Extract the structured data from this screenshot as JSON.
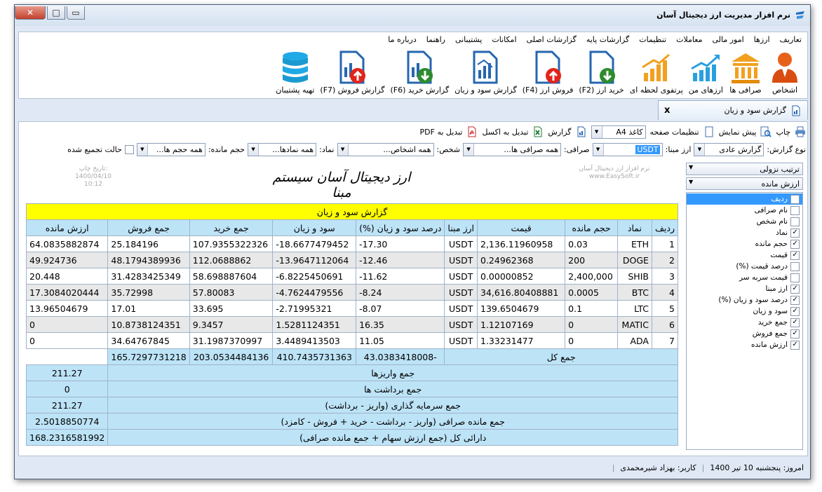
{
  "window": {
    "title": "نرم افزار مدیریت ارز دیجیتال آسان",
    "close": "✕",
    "maximize": "□",
    "minimize": "▭"
  },
  "menu": [
    "تعاریف",
    "ارزها",
    "امور مالی",
    "معاملات",
    "تنظیمات",
    "گزارشات پایه",
    "گزارشات اصلی",
    "امکانات",
    "پشتیبانی",
    "راهنما",
    "درباره ما"
  ],
  "toolbar": [
    {
      "label": "اشخاص",
      "icon": "person-icon"
    },
    {
      "label": "صرافی ها",
      "icon": "bank-icon"
    },
    {
      "label": "ارزهای من",
      "icon": "chart-up-icon"
    },
    {
      "label": "پرتفوی لحظه ای",
      "icon": "bar-chart-icon"
    },
    {
      "label": "خرید ارز (F2)",
      "icon": "buy-doc-icon"
    },
    {
      "label": "فروش ارز (F4)",
      "icon": "sell-doc-icon"
    },
    {
      "label": "گزارش سود و زیان",
      "icon": "report-icon"
    },
    {
      "label": "گزارش خرید (F6)",
      "icon": "report-buy-icon"
    },
    {
      "label": "گزارش فروش (F7)",
      "icon": "report-sell-icon"
    },
    {
      "label": "تهیه پشتیبان",
      "icon": "database-icon"
    }
  ],
  "tab": {
    "label": "گزارش سود و زیان",
    "close": "x"
  },
  "actions": {
    "print": "چاپ",
    "preview": "پیش نمایش",
    "page_settings": "تنظیمات صفحه",
    "paper": "کاغذ A4",
    "report": "گزارش",
    "excel": "تبدیل به اکسل",
    "pdf": "تبدیل به PDF"
  },
  "filters": {
    "type_label": "نوع گزارش:",
    "type_value": "گزارش عادی",
    "base_label": "ارز مبنا:",
    "base_value": "USDT",
    "exchange_label": "صرافی:",
    "exchange_value": "همه صرافی ها...",
    "person_label": "شخص:",
    "person_value": "همه اشخاص...",
    "symbol_label": "نماد:",
    "symbol_value": "همه نمادها...",
    "volume_label": "حجم مانده:",
    "volume_value": "همه حجم ها...",
    "aggregate_label": "حالت تجمیع شده"
  },
  "report": {
    "title": "ارز دیجیتال آسان سیستم مبنا",
    "print_date_label": "تاریخ چاپ:",
    "print_date": "1400/04/10",
    "print_time": "10:12",
    "company": "نرم افزار ارز دیجیتال آسان",
    "site": "www.EasySoft.ir",
    "caption": "گزارش سود و زیان",
    "columns": [
      "ردیف",
      "نماد",
      "حجم مانده",
      "قیمت",
      "ارز مبنا",
      "درصد سود و زیان (%)",
      "سود و زیان",
      "جمع خرید",
      "جمع فروش",
      "ارزش مانده"
    ],
    "rows": [
      [
        "1",
        "ETH",
        "0.03",
        "2,136.11960958",
        "USDT",
        "-17.30",
        "-18.6677479452",
        "107.9355322326",
        "25.184196",
        "64.0835882874"
      ],
      [
        "2",
        "DOGE",
        "200",
        "0.24962368",
        "USDT",
        "-12.46",
        "-13.9647112064",
        "112.0688862",
        "48.1794389936",
        "49.924736"
      ],
      [
        "3",
        "SHIB",
        "2,400,000",
        "0.00000852",
        "USDT",
        "-11.62",
        "-6.8225450691",
        "58.698887604",
        "31.4283425349",
        "20.448"
      ],
      [
        "4",
        "BTC",
        "0.0005",
        "34,616.80408881",
        "USDT",
        "-8.24",
        "-4.7624479556",
        "57.80083",
        "35.72998",
        "17.3084020444"
      ],
      [
        "5",
        "LTC",
        "0.1",
        "139.6504679",
        "USDT",
        "-8.07",
        "-2.71995321",
        "33.695",
        "17.01",
        "13.96504679"
      ],
      [
        "6",
        "MATIC",
        "0",
        "1.12107169",
        "USDT",
        "16.35",
        "1.5281124351",
        "9.3457",
        "10.8738124351",
        "0"
      ],
      [
        "7",
        "ADA",
        "0",
        "1.33231477",
        "USDT",
        "11.05",
        "3.4489413503",
        "31.1987370997",
        "34.64767845",
        "0"
      ]
    ],
    "total_label": "جمع کل",
    "total_profit": "-43.0383418008",
    "total_buy": "410.7435731363",
    "total_sell": "203.0534484136",
    "total_value": "165.7297731218",
    "summary": [
      {
        "label": "جمع واریزها",
        "value": "211.27"
      },
      {
        "label": "جمع برداشت ها",
        "value": "0"
      },
      {
        "label": "جمع سرمایه گذاری (واریز - برداشت)",
        "value": "211.27"
      },
      {
        "label": "جمع مانده صرافی (واریز - برداشت - خرید + فروش - کامزد)",
        "value": "2.5018850774"
      },
      {
        "label": "دارائی کل (جمع ارزش سهام + جمع مانده صرافی)",
        "value": "168.2316581992"
      }
    ]
  },
  "side": {
    "sort": "ترتیب نزولی",
    "sort_field": "ارزش مانده",
    "fields": [
      {
        "label": "ردیف",
        "checked": true,
        "selected": true
      },
      {
        "label": "نام صرافی",
        "checked": false
      },
      {
        "label": "نام شخص",
        "checked": false
      },
      {
        "label": "نماد",
        "checked": true
      },
      {
        "label": "حجم مانده",
        "checked": true
      },
      {
        "label": "قیمت",
        "checked": true
      },
      {
        "label": "درصد قیمت (%)",
        "checked": false
      },
      {
        "label": "قیمت سربه سر",
        "checked": false
      },
      {
        "label": "ارز مبنا",
        "checked": true
      },
      {
        "label": "درصد سود و زیان (%)",
        "checked": true
      },
      {
        "label": "سود و زیان",
        "checked": true
      },
      {
        "label": "جمع خرید",
        "checked": true
      },
      {
        "label": "جمع فروش",
        "checked": true
      },
      {
        "label": "ارزش مانده",
        "checked": true
      }
    ]
  },
  "status": {
    "today": "امروز: پنجشنبه 10 تیر 1400",
    "user": "کاربر: بهزاد شیرمحمدی"
  },
  "colors": {
    "header_bg": "#bde3f7",
    "caption_bg": "#ffff00",
    "accent": "#3399ff"
  }
}
